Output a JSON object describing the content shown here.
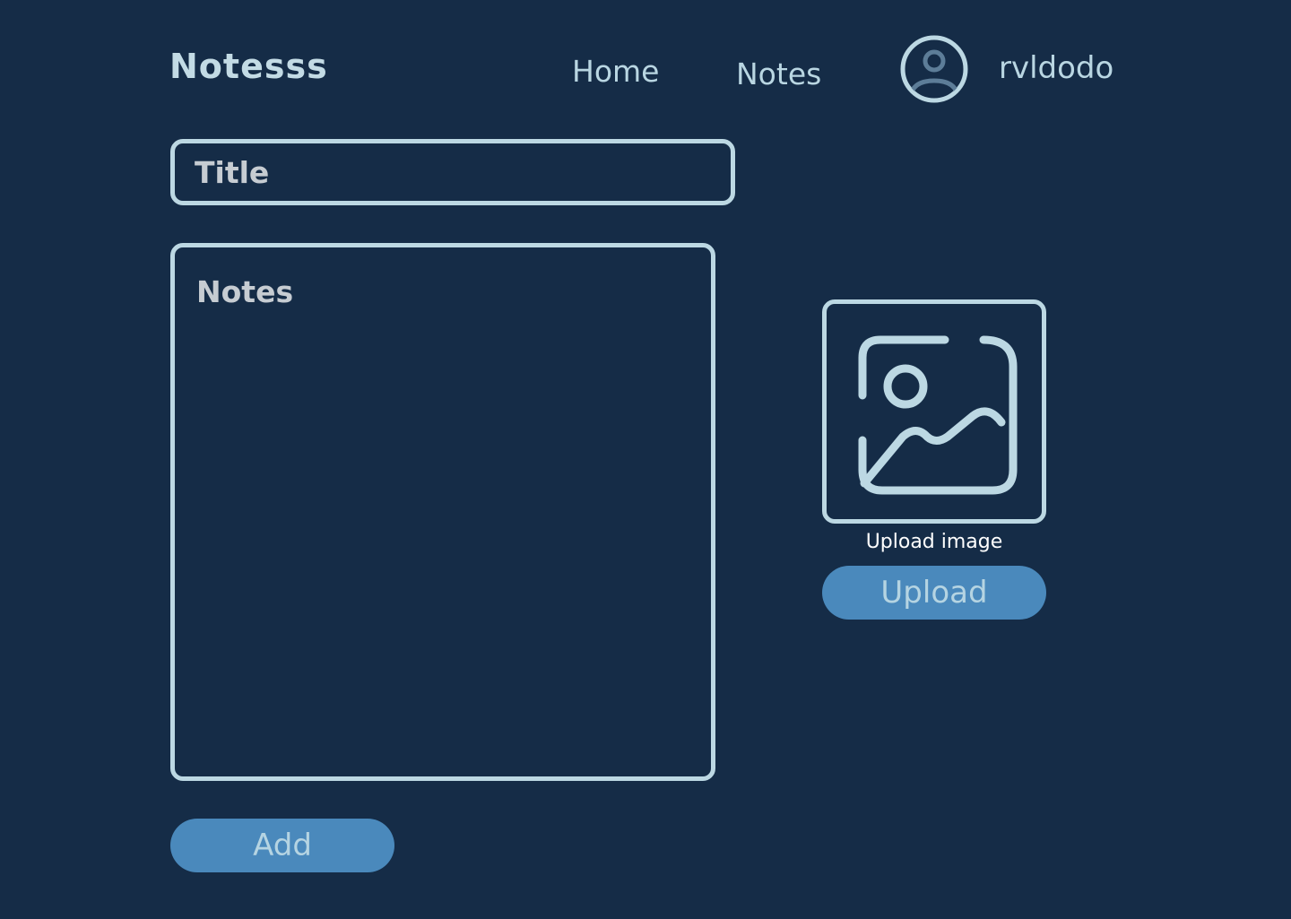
{
  "header": {
    "logo": "Notesss",
    "nav": [
      {
        "label": "Home"
      },
      {
        "label": "Notes"
      }
    ],
    "user": {
      "name": "rvldodo",
      "avatar_icon": "user-circle-icon"
    }
  },
  "form": {
    "title_placeholder": "Title",
    "title_value": "",
    "notes_placeholder": "Notes",
    "notes_value": "",
    "add_label": "Add"
  },
  "upload": {
    "icon": "image-icon",
    "label": "Upload image",
    "button_label": "Upload"
  },
  "colors": {
    "background": "#152c47",
    "border": "#bcd8e3",
    "button": "#4a89bc"
  }
}
